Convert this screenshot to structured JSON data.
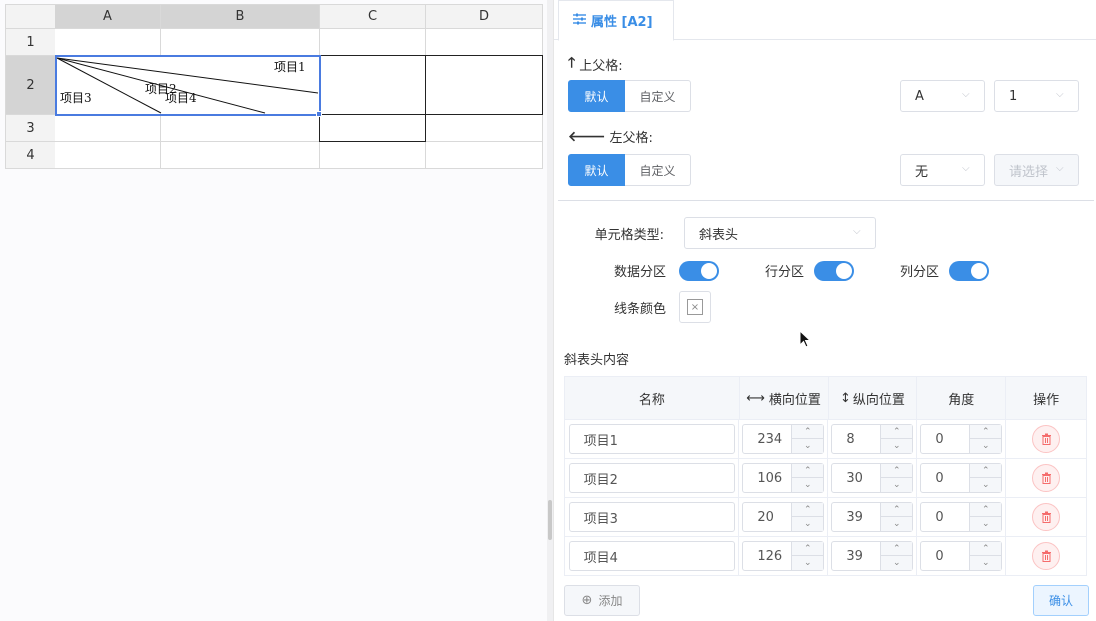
{
  "sheet": {
    "columns": [
      "A",
      "B",
      "C",
      "D"
    ],
    "rows": [
      "1",
      "2",
      "3",
      "4"
    ],
    "diagonal_labels": [
      "项目1",
      "项目2",
      "项目3",
      "项目4"
    ]
  },
  "panel": {
    "tab_label": "属性 [A2]",
    "upper_parent": {
      "label": "上父格:",
      "default_btn": "默认",
      "custom_btn": "自定义",
      "column_value": "A",
      "row_value": "1"
    },
    "left_parent": {
      "label": "左父格:",
      "default_btn": "默认",
      "custom_btn": "自定义",
      "column_value": "无",
      "row_placeholder": "请选择"
    },
    "cell_type": {
      "label": "单元格类型:",
      "value": "斜表头"
    },
    "switches": [
      {
        "label": "数据分区",
        "on": true
      },
      {
        "label": "行分区",
        "on": true
      },
      {
        "label": "列分区",
        "on": true
      }
    ],
    "line_color": {
      "label": "线条颜色"
    },
    "content_title": "斜表头内容",
    "table": {
      "headers": {
        "name": "名称",
        "h": "横向位置",
        "v": "纵向位置",
        "angle": "角度",
        "op": "操作"
      },
      "rows": [
        {
          "name": "项目1",
          "h": "234",
          "v": "8",
          "angle": "0"
        },
        {
          "name": "项目2",
          "h": "106",
          "v": "30",
          "angle": "0"
        },
        {
          "name": "项目3",
          "h": "20",
          "v": "39",
          "angle": "0"
        },
        {
          "name": "项目4",
          "h": "126",
          "v": "39",
          "angle": "0"
        }
      ]
    },
    "add_btn": "添加",
    "confirm_btn": "确认"
  },
  "colors": {
    "accent": "#3a8ee6",
    "danger": "#f56c6c"
  }
}
